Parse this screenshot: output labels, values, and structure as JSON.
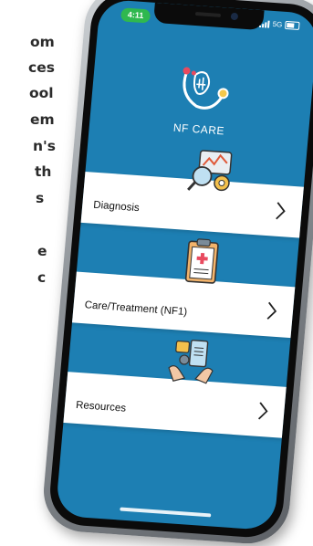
{
  "side_text": {
    "lines": [
      "om",
      "ces",
      "ool",
      "em",
      "n's",
      "th",
      "s",
      "",
      "e",
      "c"
    ]
  },
  "status_bar": {
    "time": "4:11",
    "network": "5G"
  },
  "app": {
    "title": "NF CARE"
  },
  "menu": {
    "items": [
      {
        "label": "Diagnosis",
        "icon": "diagnosis-icon"
      },
      {
        "label": "Care/Treatment (NF1)",
        "icon": "clipboard-medical-icon"
      },
      {
        "label": "Resources",
        "icon": "resources-hands-icon"
      }
    ]
  },
  "colors": {
    "screen_background": "#1d7fb3",
    "status_pill": "#2fb84f",
    "card": "#ffffff"
  }
}
